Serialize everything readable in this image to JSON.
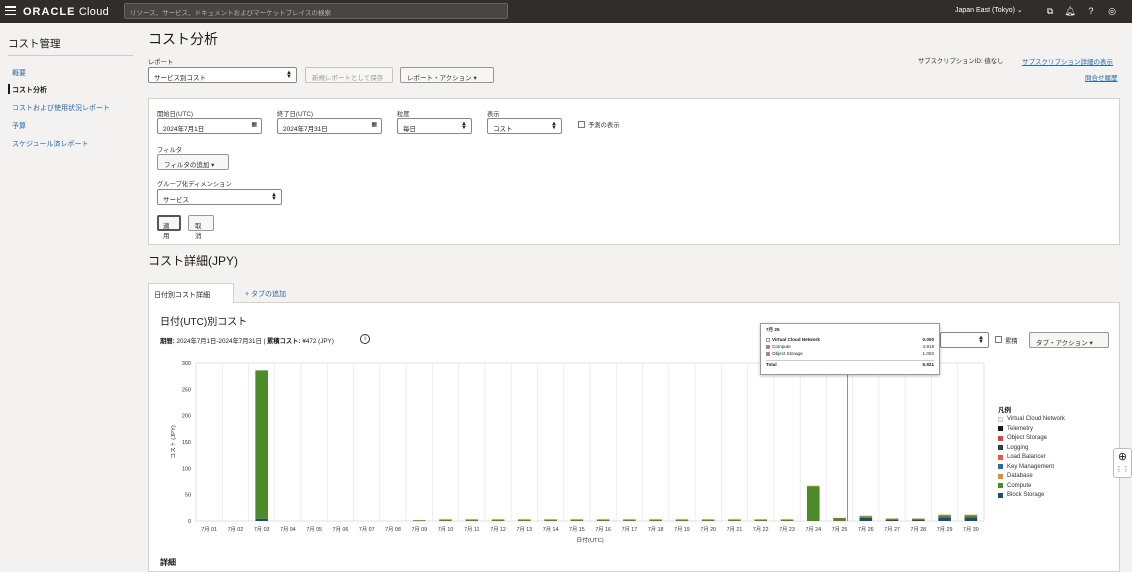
{
  "header": {
    "logo_brand": "ORACLE",
    "logo_product": "Cloud",
    "search_placeholder": "リソース、サービス、ドキュメントおよびマーケットプレイスの検索",
    "region": "Japan East (Tokyo)"
  },
  "sidebar": {
    "title": "コスト管理",
    "items": [
      {
        "label": "概要"
      },
      {
        "label": "コスト分析"
      },
      {
        "label": "コストおよび使用状況レポート"
      },
      {
        "label": "予算"
      },
      {
        "label": "スケジュール済レポート"
      }
    ]
  },
  "page": {
    "title": "コスト分析",
    "subscription_text": "サブスクリプションID: 値なし",
    "subscription_link": "サブスクリプション詳細の表示",
    "inquiry_link": "問合せ履歴"
  },
  "report": {
    "label": "レポート",
    "value": "サービス別コスト",
    "save_button": "新規レポートとして保存",
    "actions_button": "レポート・アクション"
  },
  "filters": {
    "start_label": "開始日(UTC)",
    "start_value": "2024年7月1日",
    "end_label": "終了日(UTC)",
    "end_value": "2024年7月31日",
    "granularity_label": "粒度",
    "granularity_value": "毎日",
    "show_label": "表示",
    "show_value": "コスト",
    "forecast_label": "予測の表示",
    "filter_label": "フィルタ",
    "filter_button": "フィルタの追加",
    "group_label": "グループ化ディメンション",
    "group_value": "サービス",
    "apply_button": "適用",
    "cancel_button": "取消"
  },
  "details": {
    "title": "コスト詳細(JPY)",
    "tab_label": "日付別コスト詳細",
    "add_tab": "+ タブの追加"
  },
  "chart_panel": {
    "title": "日付(UTC)別コスト",
    "period_label": "期間:",
    "period_value": "2024年7月1日-2024年7月31日",
    "cumulative_label": "累積コスト:",
    "cumulative_value": "¥472 (JPY)",
    "cumulative_checkbox": "累積",
    "tab_actions": "タブ・アクション",
    "detail_heading": "詳細"
  },
  "tooltip": {
    "title": "7月 25",
    "rows": [
      {
        "name": "Virtual Cloud Network",
        "value": "0.000",
        "color": "#ffffff"
      },
      {
        "name": "Compute",
        "value": "4.919",
        "color": "#e0567a"
      },
      {
        "name": "Object Storage",
        "value": "1.002",
        "color": "#e0567a"
      }
    ],
    "total_label": "Total",
    "total_value": "5.921"
  },
  "legend": {
    "title": "凡例",
    "items": [
      {
        "name": "Virtual Cloud Network",
        "color": "#f2f2f2"
      },
      {
        "name": "Telemetry",
        "color": "#1a1a1a"
      },
      {
        "name": "Object Storage",
        "color": "#d9473b"
      },
      {
        "name": "Logging",
        "color": "#333a48"
      },
      {
        "name": "Load Balancer",
        "color": "#e35d3f"
      },
      {
        "name": "Key Management",
        "color": "#2a6f9c"
      },
      {
        "name": "Database",
        "color": "#e08a3c"
      },
      {
        "name": "Compute",
        "color": "#4d8a2a"
      },
      {
        "name": "Block Storage",
        "color": "#1f4e6b"
      }
    ]
  },
  "chart_data": {
    "type": "bar",
    "xlabel": "日付(UTC)",
    "ylabel": "コスト (JPY)",
    "ylim": [
      0,
      300
    ],
    "yticks": [
      0,
      50,
      100,
      150,
      200,
      250,
      300
    ],
    "categories": [
      "7月 01",
      "7月 02",
      "7月 03",
      "7月 04",
      "7月 05",
      "7月 06",
      "7月 07",
      "7月 08",
      "7月 09",
      "7月 10",
      "7月 11",
      "7月 12",
      "7月 13",
      "7月 14",
      "7月 15",
      "7月 16",
      "7月 17",
      "7月 18",
      "7月 19",
      "7月 20",
      "7月 21",
      "7月 22",
      "7月 23",
      "7月 24",
      "7月 25",
      "7月 26",
      "7月 27",
      "7月 28",
      "7月 29",
      "7月 30"
    ],
    "series": [
      {
        "name": "Block Storage",
        "values": [
          0,
          0,
          4,
          0,
          0,
          0,
          0,
          0,
          0,
          0,
          0,
          0,
          0,
          0,
          0,
          0,
          0,
          0,
          0,
          0,
          0,
          0,
          0,
          0,
          0,
          6,
          2,
          2,
          7,
          7
        ]
      },
      {
        "name": "Compute",
        "values": [
          0,
          0,
          282,
          0,
          0,
          0,
          0,
          0,
          1,
          2,
          2,
          2,
          2,
          2,
          2,
          2,
          2,
          2,
          2,
          2,
          2,
          2,
          2,
          66,
          4.9,
          3,
          2,
          2,
          4,
          4
        ]
      },
      {
        "name": "Database",
        "values": [
          0,
          0,
          0,
          0,
          0,
          0,
          0,
          0,
          1,
          1.5,
          1.5,
          1.5,
          1.5,
          1.5,
          1.5,
          1.5,
          1.5,
          1.5,
          1.5,
          1.5,
          1.5,
          1.5,
          1.5,
          1,
          0,
          1,
          1,
          1,
          1,
          1
        ]
      },
      {
        "name": "Object Storage",
        "values": [
          0,
          0,
          0,
          0,
          0,
          0,
          0,
          0,
          0,
          0,
          0,
          0,
          0,
          0,
          0,
          0,
          0,
          0,
          0,
          0,
          0,
          0,
          0,
          0,
          1,
          0,
          0,
          0,
          0,
          0
        ]
      }
    ]
  }
}
